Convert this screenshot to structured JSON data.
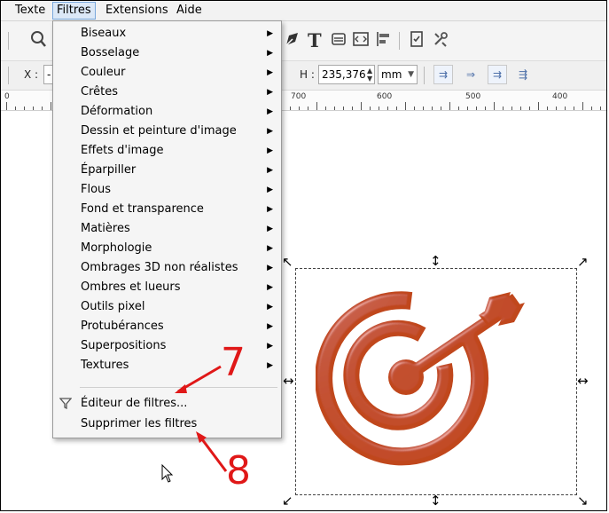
{
  "menubar": {
    "items": [
      "Texte",
      "Filtres",
      "Extensions",
      "Aide"
    ],
    "active": "Filtres"
  },
  "toolbar": {
    "icons": [
      "zoom-icon",
      "text-tool-icon",
      "align-icon",
      "distribute-icon",
      "xml-editor-icon",
      "document-properties-icon",
      "preferences-icon"
    ],
    "x_label": "X :",
    "x_value": "-",
    "h_label": "H :",
    "h_value": "235,376",
    "unit": "mm"
  },
  "ruler": {
    "labels": [
      "0",
      "700",
      "600",
      "500",
      "400"
    ]
  },
  "filters_menu": {
    "submenus": [
      "Biseaux",
      "Bosselage",
      "Couleur",
      "Crêtes",
      "Déformation",
      "Dessin et peinture d'image",
      "Effets d'image",
      "Éparpiller",
      "Flous",
      "Fond et transparence",
      "Matières",
      "Morphologie",
      "Ombrages 3D non réalistes",
      "Ombres et lueurs",
      "Outils pixel",
      "Protubérances",
      "Superpositions",
      "Textures"
    ],
    "filter_editor": "Éditeur de filtres...",
    "remove_filters": "Supprimer les filtres"
  },
  "annotations": {
    "step_a": "7",
    "step_b": "8"
  },
  "colors": {
    "target_fill": "#c0461c",
    "annotation_red": "#e01818",
    "menu_highlight": "#dbe8f7"
  }
}
